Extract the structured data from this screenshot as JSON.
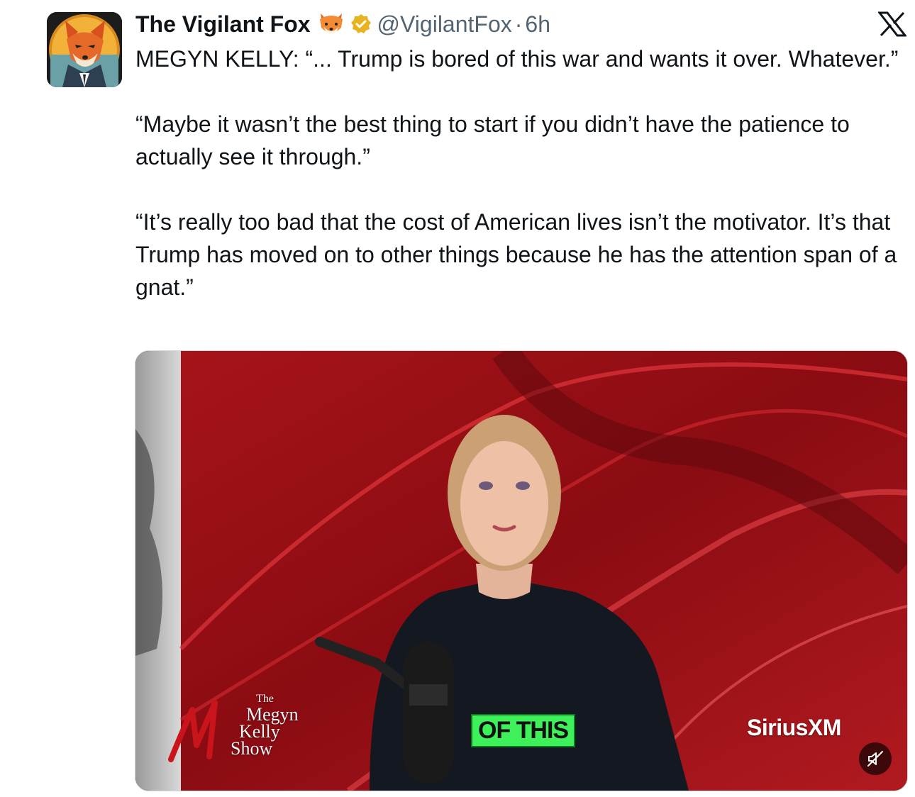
{
  "tweet": {
    "display_name": "The Vigilant Fox",
    "display_name_emoji": "🦊",
    "handle": "@VigilantFox",
    "separator": "·",
    "time_ago": "6h",
    "paragraphs": [
      "MEGYN KELLY: “... Trump is bored of this war and wants it over. Whatever.”",
      "“Maybe it wasn’t the best thing to start if you didn’t have the patience to actually see it through.”",
      "“It’s really too bad that the cost of American lives isn’t the motivator. It’s that Trump has moved on to other things because he has the attention span of a gnat.”"
    ]
  },
  "icons": {
    "avatar": "fox-avatar",
    "verified": "verified-badge-icon",
    "platform": "x-logo-icon",
    "mute": "mute-icon"
  },
  "media": {
    "caption": "OF THIS",
    "network_logo": "SiriusXM",
    "show_logo": {
      "line1": "The",
      "line2": "Megyn",
      "line3": "Kelly",
      "line4": "Show"
    }
  },
  "colors": {
    "text": "#0f1419",
    "secondary_text": "#536471",
    "verified_gold": "#e8b320",
    "caption_green": "#3ef05a"
  }
}
